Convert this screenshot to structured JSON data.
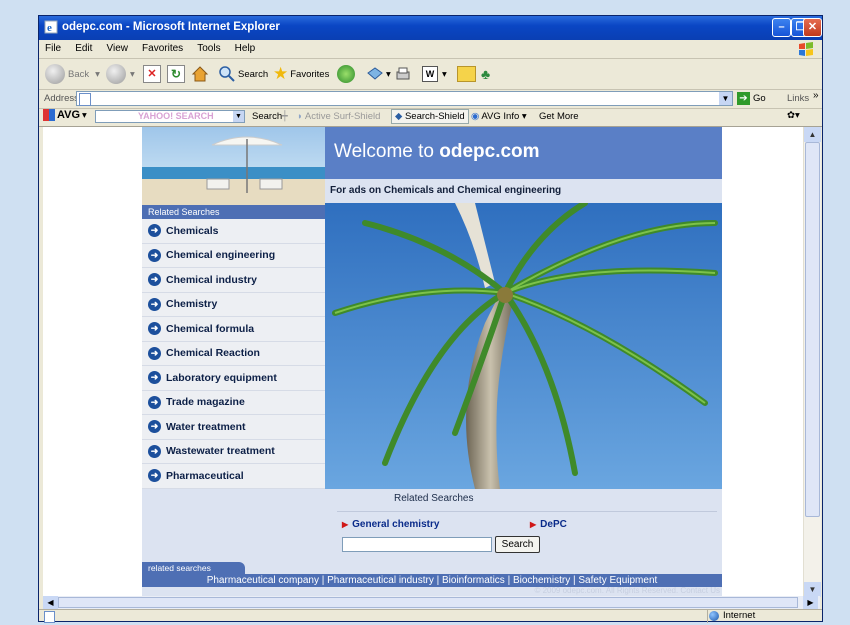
{
  "window": {
    "title": "odepc.com - Microsoft Internet Explorer"
  },
  "menu": [
    "File",
    "Edit",
    "View",
    "Favorites",
    "Tools",
    "Help"
  ],
  "toolbar": {
    "back": "Back",
    "search": "Search",
    "favorites": "Favorites"
  },
  "address": {
    "label": "Address",
    "value": "",
    "go": "Go",
    "links": "Links"
  },
  "avgbar": {
    "brand": "AVG",
    "yahoo": "YAHOO! SEARCH",
    "search": "Search",
    "active_surf": "Active Surf-Shield",
    "search_shield": "Search-Shield",
    "avg_info": "AVG Info",
    "get_more": "Get More"
  },
  "page": {
    "welcome_prefix": "Welcome to ",
    "welcome_site": "odepc.com",
    "subtitle": "For ads on Chemicals and Chemical engineering",
    "related_header": "Related Searches",
    "nav": [
      "Chemicals",
      "Chemical engineering",
      "Chemical industry",
      "Chemistry",
      "Chemical formula",
      "Chemical Reaction",
      "Laboratory equipment",
      "Trade magazine",
      "Water treatment",
      "Wastewater treatment",
      "Pharmaceutical"
    ],
    "lower_related": "Related Searches",
    "links": [
      "General chemistry",
      "DePC"
    ],
    "search_button": "Search",
    "search_value": "",
    "tab_label": "related searches",
    "footer_links": "Pharmaceutical company  |  Pharmaceutical industry  |  Bioinformatics  |  Biochemistry  |  Safety Equipment",
    "copyright": "© 2009 odepc.com. All Rights Reserved. Contact Us"
  },
  "status": {
    "zone": "Internet"
  }
}
